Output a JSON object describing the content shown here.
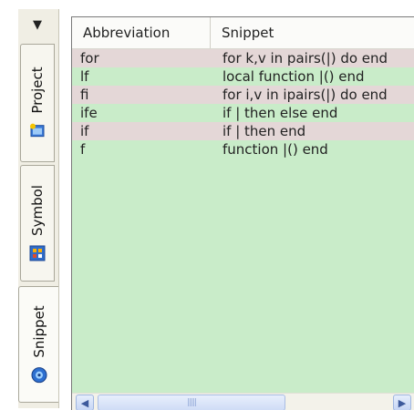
{
  "tabs": [
    {
      "label": "Project",
      "icon": "project-icon",
      "active": false
    },
    {
      "label": "Symbol",
      "icon": "symbol-icon",
      "active": false
    },
    {
      "label": "Snippet",
      "icon": "snippet-icon",
      "active": true
    }
  ],
  "tabstrip": {
    "arrow_glyph": "▼"
  },
  "table": {
    "headers": {
      "abbreviation": "Abbreviation",
      "snippet": "Snippet"
    },
    "rows": [
      {
        "abbreviation": "for",
        "snippet": "for k,v in pairs(|) do  end",
        "shade": "pink"
      },
      {
        "abbreviation": "lf",
        "snippet": "local function |()  end",
        "shade": "green"
      },
      {
        "abbreviation": "fi",
        "snippet": "for i,v in ipairs(|) do  end",
        "shade": "pink"
      },
      {
        "abbreviation": "ife",
        "snippet": "if | then  else  end",
        "shade": "green"
      },
      {
        "abbreviation": "if",
        "snippet": "if | then  end",
        "shade": "pink"
      },
      {
        "abbreviation": "f",
        "snippet": "function |()  end",
        "shade": "green"
      }
    ]
  },
  "scrollbar": {
    "left_glyph": "◀",
    "right_glyph": "▶",
    "grip_glyph": "|||||"
  },
  "colors": {
    "row_pink": "#e4d7d7",
    "row_green": "#c9ecc9",
    "tabstrip_bg": "#f0eee4"
  }
}
